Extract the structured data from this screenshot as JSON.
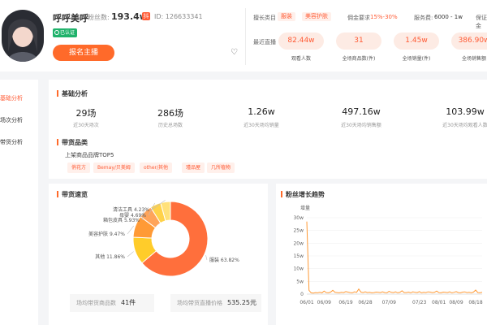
{
  "header": {
    "name": "呼呼美呼",
    "fans_label": "粉丝数:",
    "fans_value": "193.4w",
    "id_label": "ID:",
    "id_value": "126633341",
    "verified": "已认证",
    "register_button": "报名主播",
    "heart_icon": "heart-icon",
    "growth_category_label": "擅长类目",
    "growth_tags": [
      "服装",
      "美容护肤"
    ],
    "commission_label": "佣金要求",
    "commission_value": "15%-30%",
    "service_fee_label": "服务费:",
    "service_fee_value": "6000 - 1w",
    "guarantee_label": "保证金",
    "recent_label": "最近直播",
    "pills": [
      {
        "value": "82.44w",
        "label": "观看人数"
      },
      {
        "value": "31",
        "label": "全场商品数(件)"
      },
      {
        "value": "1.45w",
        "label": "全场销量(件)"
      },
      {
        "value": "386.90w",
        "label": "全场销售额"
      }
    ]
  },
  "sidebar": {
    "items": [
      {
        "label": "基础分析",
        "active": true
      },
      {
        "label": "场次分析",
        "active": false
      },
      {
        "label": "带货分析",
        "active": false
      }
    ]
  },
  "basic": {
    "title": "基础分析",
    "stats": [
      {
        "value": "29场",
        "label": "近30天场次"
      },
      {
        "value": "286场",
        "label": "历史总场数"
      },
      {
        "value": "1.26w",
        "label": "近30天场均销量"
      },
      {
        "value": "497.16w",
        "label": "近30天场均销售额"
      },
      {
        "value": "103.99w",
        "label": "近30天场均观看人数"
      }
    ],
    "category_title": "带货品类",
    "brand_title": "上架商品品牌TOP5",
    "brands": [
      "俏花方",
      "Bemay/贝美姆",
      "other/其他",
      "瑾品屋",
      "几所植物"
    ]
  },
  "overview": {
    "title": "带货速览",
    "avg_items_label": "场均带货商品数",
    "avg_items_value": "41件",
    "avg_price_label": "场均带货直播价格",
    "avg_price_value": "535.25元"
  },
  "fans": {
    "title": "粉丝增长趋势"
  },
  "chart_data": [
    {
      "type": "pie",
      "title": "带货速览",
      "categories": [
        "服装",
        "其他",
        "美容护肤",
        "母婴",
        "箱包皮具",
        "清洁工具"
      ],
      "values": [
        63.82,
        11.86,
        9.47,
        5.93,
        4.69,
        4.23
      ],
      "labels": [
        "服装 63.82%",
        "其他 11.86%",
        "美容护肤 9.47%",
        "箱包皮具 5.93%",
        "母婴 4.69%",
        "清洁工具 4.23%"
      ],
      "colors": [
        "#ff6f3c",
        "#ffcc2a",
        "#ff9a36",
        "#ffa45a",
        "#ffd24a",
        "#ffe17a"
      ]
    },
    {
      "type": "line",
      "title": "粉丝增长趋势",
      "ylabel": "增量",
      "yticks": [
        "0",
        "5w",
        "10w",
        "15w",
        "20w",
        "25w",
        "30w"
      ],
      "xticks": [
        "06/01",
        "06/09",
        "06/19",
        "06/28",
        "07/09",
        "07/23",
        "08/01",
        "08/09",
        "08/18"
      ],
      "ylim": [
        0,
        30
      ],
      "x": [
        "06/01",
        "06/02",
        "06/03",
        "06/04",
        "06/05",
        "06/06",
        "06/07",
        "06/08",
        "06/09",
        "06/10",
        "06/11",
        "06/12",
        "06/13",
        "06/14",
        "06/15",
        "06/16",
        "06/17",
        "06/18",
        "06/19",
        "06/20",
        "06/21",
        "06/22",
        "06/23",
        "06/24",
        "06/25",
        "06/26",
        "06/27",
        "06/28",
        "06/29",
        "06/30",
        "07/01",
        "07/02",
        "07/03",
        "07/04",
        "07/05",
        "07/06",
        "07/07",
        "07/08",
        "07/09",
        "07/10",
        "07/11",
        "07/12",
        "07/13",
        "07/14",
        "07/15",
        "07/16",
        "07/17",
        "07/18",
        "07/19",
        "07/20",
        "07/21",
        "07/22",
        "07/23",
        "07/24",
        "07/25",
        "07/26",
        "07/27",
        "07/28",
        "07/29",
        "07/30",
        "07/31",
        "08/01",
        "08/02",
        "08/03",
        "08/04",
        "08/05",
        "08/06",
        "08/07",
        "08/08",
        "08/09",
        "08/10",
        "08/11",
        "08/12",
        "08/13",
        "08/14",
        "08/15",
        "08/16",
        "08/17",
        "08/18",
        "08/19",
        "08/20",
        "08/21"
      ],
      "series": [
        {
          "color": "#ff9a36",
          "values": [
            28.5,
            1.5,
            0.5,
            0.4,
            0.6,
            0.5,
            0.7,
            0.5,
            1.2,
            0.6,
            0.5,
            0.8,
            1.5,
            0.7,
            0.6,
            0.5,
            0.7,
            0.6,
            1.0,
            0.8,
            0.6,
            0.5,
            0.9,
            0.7,
            2.0,
            0.8,
            0.6,
            0.9,
            0.6,
            0.7,
            0.5,
            0.6,
            0.8,
            0.7,
            0.6,
            0.9,
            0.6,
            0.5,
            1.1,
            0.7,
            0.6,
            0.9,
            0.5,
            0.7,
            1.3,
            0.6,
            0.6,
            0.8,
            0.5,
            0.9,
            0.7,
            0.6,
            1.0,
            0.5,
            0.7,
            0.6,
            0.9,
            0.8,
            0.6,
            0.7,
            1.2,
            0.6,
            0.5,
            0.8,
            0.7,
            0.6,
            0.9,
            0.5,
            0.7,
            1.0,
            0.6,
            0.5,
            0.8,
            0.9,
            0.6,
            0.7,
            0.5,
            0.8,
            1.6,
            0.6,
            0.5,
            0.7
          ]
        }
      ]
    }
  ]
}
